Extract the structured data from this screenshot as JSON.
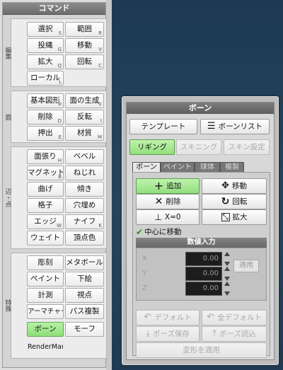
{
  "command_panel": {
    "title": "コマンド",
    "sections": {
      "edit": {
        "label": "編集",
        "buttons": [
          {
            "label": "選択",
            "key": "S"
          },
          {
            "label": "範囲",
            "key": "R"
          },
          {
            "label": "投縄",
            "key": "G"
          },
          {
            "label": "移動",
            "key": "V"
          },
          {
            "label": "拡大",
            "key": "Q"
          },
          {
            "label": "回転",
            "key": "C"
          },
          {
            "label": "ローカル",
            "key": "L"
          }
        ]
      },
      "face": {
        "label": "面",
        "buttons": [
          {
            "label": "基本図形",
            "key": "P"
          },
          {
            "label": "面の生成",
            "key": "F"
          },
          {
            "label": "削除",
            "key": "D"
          },
          {
            "label": "反転",
            "key": "I"
          },
          {
            "label": "押出",
            "key": "E"
          },
          {
            "label": "材質",
            "key": "M"
          }
        ]
      },
      "edge": {
        "label": "辺・点",
        "buttons": [
          {
            "label": "面張り",
            "key": "H"
          },
          {
            "label": "ベベル",
            "key": ""
          },
          {
            "label": "マグネット",
            "key": "B"
          },
          {
            "label": "ねじれ",
            "key": ""
          },
          {
            "label": "曲げ",
            "key": ""
          },
          {
            "label": "傾き",
            "key": ""
          },
          {
            "label": "格子",
            "key": ""
          },
          {
            "label": "穴埋め",
            "key": ""
          },
          {
            "label": "エッジ",
            "key": "W"
          },
          {
            "label": "ナイフ",
            "key": "K"
          },
          {
            "label": "ウェイト",
            "key": ""
          },
          {
            "label": "頂点色",
            "key": ""
          }
        ]
      },
      "special": {
        "label": "特殊",
        "buttons": [
          {
            "label": "彫刻",
            "key": ""
          },
          {
            "label": "メタボール",
            "key": ""
          },
          {
            "label": "ペイント",
            "key": ""
          },
          {
            "label": "下絵",
            "key": ""
          },
          {
            "label": "計測",
            "key": ""
          },
          {
            "label": "視点",
            "key": ""
          },
          {
            "label": "アーマチャー",
            "key": ""
          },
          {
            "label": "パス複製",
            "key": ""
          },
          {
            "label": "ボーン",
            "key": ""
          },
          {
            "label": "モーフ",
            "key": ""
          },
          {
            "label": "RenderMan",
            "key": ""
          }
        ]
      }
    }
  },
  "bone_panel": {
    "title": "ボーン",
    "template_label": "テンプレート",
    "bone_list_label": "ボーンリスト",
    "rigging_label": "リギング",
    "skinning_label": "スキニング",
    "skin_settings_label": "スキン設定",
    "tabs": [
      "ボーン",
      "ペイント",
      "球体",
      "複製"
    ],
    "tools": {
      "add": "追加",
      "move": "移動",
      "delete": "削除",
      "rotate": "回転",
      "x0": "X=0",
      "scale": "拡大"
    },
    "center_move_label": "中心に移動",
    "numeric_input_label": "数値入力",
    "axes": [
      "X",
      "Y",
      "Z"
    ],
    "values": [
      "0.00",
      "0.00",
      "0.00"
    ],
    "apply_label": "適用",
    "default_label": "デフォルト",
    "all_default_label": "全デフォルト",
    "pose_save_label": "ポーズ保存",
    "pose_load_label": "ポーズ読込",
    "apply_transform_label": "変形を適用"
  },
  "colors": {
    "active_green": "#93de7d",
    "background_blue": "#25455f",
    "field_dark": "#1d1d1d"
  }
}
